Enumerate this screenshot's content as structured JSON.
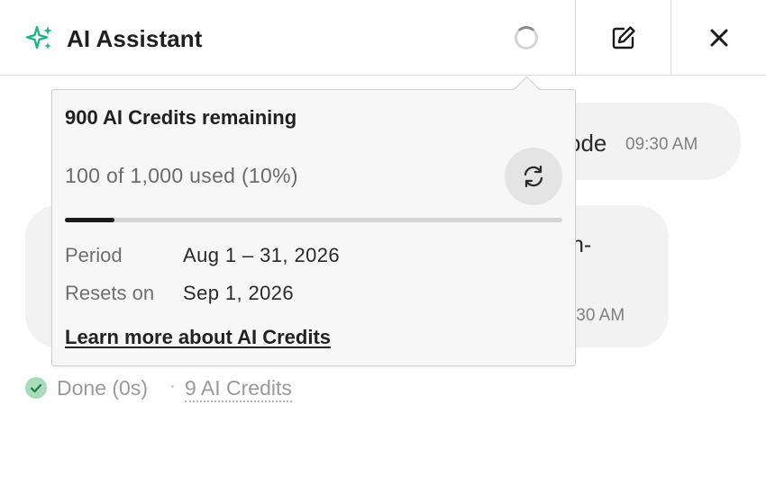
{
  "header": {
    "title": "AI Assistant",
    "sparkle_icon": "sparkle-icon",
    "accent_color": "#1db48c",
    "loading_icon": "spinner-icon",
    "edit_icon": "edit-icon",
    "close_icon": "close-icon"
  },
  "messages": [
    {
      "role": "user",
      "partial_text": "ode",
      "time": "09:30 AM"
    },
    {
      "role": "assistant",
      "partial_text": "h-",
      "partial_time": ":30 AM"
    }
  ],
  "status": {
    "done_label": "Done (0s)",
    "separator": "·",
    "credits_label": "9 AI Credits",
    "done_color": "#3cb371"
  },
  "popover": {
    "title": "900 AI Credits remaining",
    "usage_text": "100 of 1,000 used (10%)",
    "usage_fraction": 0.1,
    "refresh_icon": "refresh-icon",
    "rows": [
      {
        "label": "Period",
        "value": "Aug 1 – 31, 2026"
      },
      {
        "label": "Resets on",
        "value": "Sep 1, 2026"
      }
    ],
    "learn_more": "Learn more about AI Credits"
  }
}
